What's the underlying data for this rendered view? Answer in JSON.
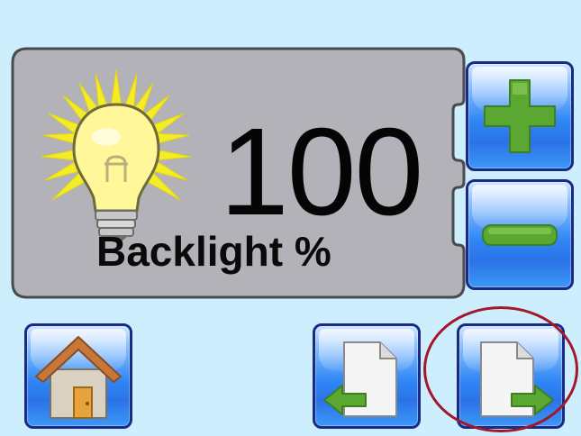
{
  "backlight": {
    "value": "100",
    "label": "Backlight %"
  },
  "icons": {
    "bulb": "light-bulb-icon",
    "plus": "plus-icon",
    "minus": "minus-icon",
    "home": "home-icon",
    "prev": "page-back-arrow-icon",
    "next": "page-forward-arrow-icon"
  },
  "colors": {
    "background": "#cdeefc",
    "panel": "#b2b2b8",
    "button_border": "#1a2a86",
    "button_fill": "#2f86f5",
    "icon_green": "#5aa832",
    "highlight_ring": "#a3172a"
  }
}
